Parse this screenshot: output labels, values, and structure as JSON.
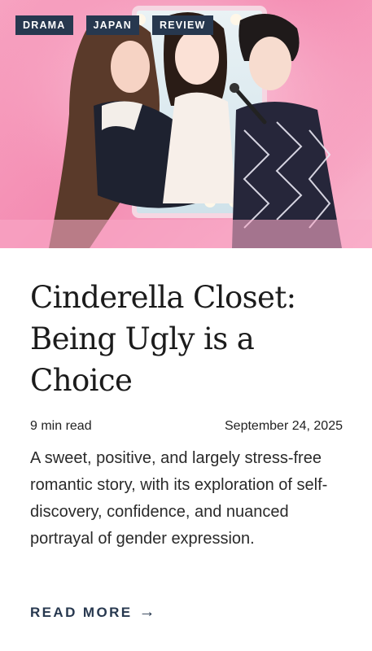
{
  "article": {
    "tags": [
      "DRAMA",
      "JAPAN",
      "REVIEW"
    ],
    "title": "Cinderella Closet: Being Ugly is a Choice",
    "read_time": "9 min read",
    "date": "September 24, 2025",
    "excerpt": "A sweet, positive, and largely stress-free romantic story, with its exploration of self-discovery, confidence, and nuanced portrayal of gender expression.",
    "read_more_label": "READ MORE",
    "read_more_icon": "arrow-right-icon"
  },
  "colors": {
    "tag_background": "#27384f",
    "hero_pink": "#f48cb2",
    "link": "#27384f"
  }
}
